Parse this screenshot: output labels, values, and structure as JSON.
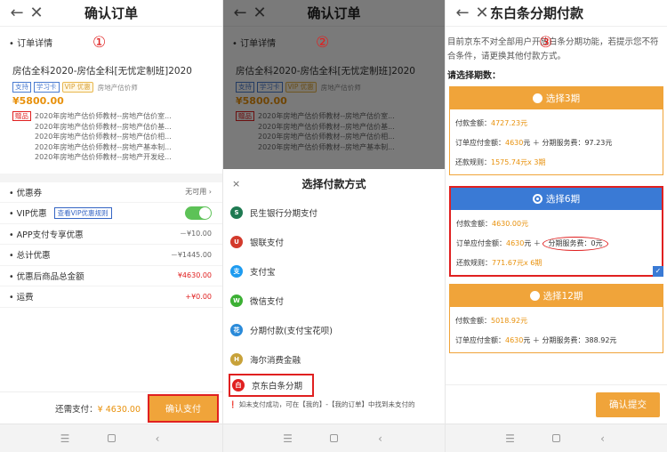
{
  "screen1": {
    "title": "确认订单",
    "annotation": "①",
    "section_title": "• 订单详情",
    "product_name": "房估全科2020-房估全科[无忧定制班]2020",
    "tags": [
      "支持",
      "学习卡"
    ],
    "vip_tag": "VIP 优惠",
    "category": "房地产估价师",
    "price": "¥5800.00",
    "gift_tag": "赠品",
    "gifts": [
      "2020年房地产估价师教材--房地产估价室...",
      "2020年房地产估价师教材--房地产估价基...",
      "2020年房地产估价师教材--房地产估价相...",
      "2020年房地产估价师教材--房地产基本制...",
      "2020年房地产估价师教材--房地产开发经..."
    ],
    "coupon_label": "• 优惠券",
    "coupon_value": "无可用 ›",
    "vip_label": "• VIP优惠",
    "vip_rule": "查看VIP优惠规则",
    "app_label": "• APP支付专享优惠",
    "app_value": "－¥10.00",
    "total_disc_label": "• 总计优惠",
    "total_disc_value": "－¥1445.00",
    "after_label": "• 优惠后商品总金额",
    "after_value": "¥4630.00",
    "freight_label": "• 运费",
    "freight_value": "+¥0.00",
    "pay_label": "还需支付：",
    "pay_value": "¥ 4630.00",
    "confirm_btn": "确认支付"
  },
  "screen2": {
    "title": "确认订单",
    "annotation": "②",
    "sheet_title": "选择付款方式",
    "close": "×",
    "methods": [
      {
        "label": "民生银行分期支付",
        "icon": "minsheng-bank-icon",
        "color": "#1f7a52",
        "glyph": "S"
      },
      {
        "label": "银联支付",
        "icon": "unionpay-icon",
        "color": "#d33a2c",
        "glyph": "U"
      },
      {
        "label": "支付宝",
        "icon": "alipay-icon",
        "color": "#1d9bf0",
        "glyph": "支"
      },
      {
        "label": "微信支付",
        "icon": "wechat-pay-icon",
        "color": "#3cb034",
        "glyph": "W"
      },
      {
        "label": "分期付款(支付宝花呗)",
        "icon": "huabei-icon",
        "color": "#2a8ad9",
        "glyph": "花"
      },
      {
        "label": "海尔消费金融",
        "icon": "haier-finance-icon",
        "color": "#c8a23a",
        "glyph": "H"
      },
      {
        "label": "京东白条分期",
        "icon": "jd-baitiao-icon",
        "color": "#e02020",
        "glyph": "白"
      }
    ],
    "note": "如未支付成功，可在【我的】-【我的订单】中找到未支付的"
  },
  "screen3": {
    "title": "东白条分期付款",
    "annotation": "③",
    "warning": "目前京东不对全部用户开放白条分期功能，若提示您不符合条件，请更换其他付款方式。",
    "choose_label": "请选择期数：",
    "plans": [
      {
        "title": "选择3期",
        "amount_label": "付款金额：",
        "amount": "4727.23元",
        "order_label": "订单应付金额：",
        "order_amount": "4630",
        "fee_text": "元 ＋ 分期服务费：97.23元",
        "rule_label": "还款规则：",
        "rule": "1575.74元x 3期"
      },
      {
        "title": "选择6期",
        "amount_label": "付款金额：",
        "amount": "4630.00元",
        "order_label": "订单应付金额：",
        "order_amount": "4630",
        "fee_pre": "元 ＋ ",
        "fee_text": "分期服务费：0元",
        "rule_label": "还款规则：",
        "rule": "771.67元x 6期"
      },
      {
        "title": "选择12期",
        "amount_label": "付款金额：",
        "amount": "5018.92元",
        "order_label": "订单应付金额：",
        "order_amount": "4630",
        "fee_text": "元 ＋ 分期服务费：388.92元"
      }
    ],
    "submit_btn": "确认提交"
  }
}
